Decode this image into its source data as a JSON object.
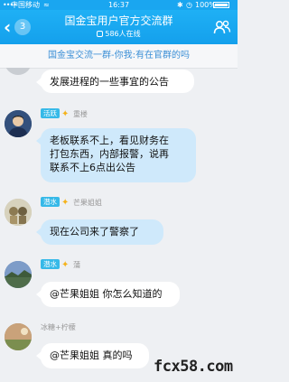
{
  "status_bar": {
    "signal": "••••",
    "carrier": "中国移动",
    "wifi": "≈",
    "time": "16:37",
    "battery_pct": "100%"
  },
  "nav": {
    "back_badge": "3",
    "title": "国金宝用户官方交流群",
    "online": "586人在线"
  },
  "banner": {
    "text": "国金宝交流一群-你我:有在官群的吗"
  },
  "messages": [
    {
      "text": "发展进程的一些事宜的公告"
    },
    {
      "level": "活跃",
      "nick": "重楼",
      "text_lines": [
        "老板联系不上，看见财务在",
        "打包东西，内部报警，说再",
        "联系不上6点出公告"
      ]
    },
    {
      "level": "潜水",
      "nick": "芒果姐姐",
      "text": "现在公司来了警察了"
    },
    {
      "level": "潜水",
      "nick": "蒲",
      "text": "@芒果姐姐 你怎么知道的"
    },
    {
      "nick": "冰糖+柠檬",
      "text": "@芒果姐姐 真的吗"
    }
  ],
  "watermark": "fcx58.com",
  "colors": {
    "nav_blue": "#1aa6f0",
    "bubble_blue": "#cfe9fb",
    "level_badge": "#36b9e8",
    "banner_text": "#3b8fd6"
  }
}
